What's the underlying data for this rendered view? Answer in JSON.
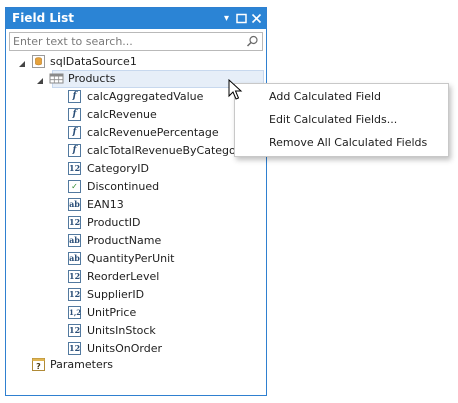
{
  "panel": {
    "title": "Field List",
    "buttons": [
      {
        "name": "dropdown-icon",
        "glyph": "▾"
      },
      {
        "name": "maximize-icon",
        "glyph": "□"
      },
      {
        "name": "close-icon",
        "glyph": "✕"
      }
    ]
  },
  "search": {
    "value": "",
    "placeholder": "Enter text to search...",
    "icon": "search-icon"
  },
  "tree": {
    "datasource": {
      "label": "sqlDataSource1",
      "icon": "database-icon",
      "expanded": true
    },
    "table": {
      "label": "Products",
      "icon": "table-icon",
      "expanded": true,
      "selected": true
    },
    "fields": [
      {
        "label": "calcAggregatedValue",
        "type": "calculated",
        "glyph": "f"
      },
      {
        "label": "calcRevenue",
        "type": "calculated",
        "glyph": "f"
      },
      {
        "label": "calcRevenuePercentage",
        "type": "calculated",
        "glyph": "f"
      },
      {
        "label": "calcTotalRevenueByCategory",
        "type": "calculated",
        "glyph": "f"
      },
      {
        "label": "CategoryID",
        "type": "integer",
        "glyph": "12"
      },
      {
        "label": "Discontinued",
        "type": "boolean",
        "glyph": "✓"
      },
      {
        "label": "EAN13",
        "type": "string",
        "glyph": "ab"
      },
      {
        "label": "ProductID",
        "type": "integer",
        "glyph": "12"
      },
      {
        "label": "ProductName",
        "type": "string",
        "glyph": "ab"
      },
      {
        "label": "QuantityPerUnit",
        "type": "string",
        "glyph": "ab"
      },
      {
        "label": "ReorderLevel",
        "type": "integer",
        "glyph": "12"
      },
      {
        "label": "SupplierID",
        "type": "integer",
        "glyph": "12"
      },
      {
        "label": "UnitPrice",
        "type": "decimal",
        "glyph": "1,2"
      },
      {
        "label": "UnitsInStock",
        "type": "integer",
        "glyph": "12"
      },
      {
        "label": "UnitsOnOrder",
        "type": "integer",
        "glyph": "12"
      }
    ],
    "parameters": {
      "label": "Parameters",
      "icon": "parameters-icon",
      "glyph": "?"
    }
  },
  "context_menu": {
    "items": [
      {
        "label": "Add Calculated Field"
      },
      {
        "label": "Edit Calculated Fields..."
      },
      {
        "label": "Remove All Calculated Fields"
      }
    ]
  },
  "colors": {
    "titlebar": "#2b84d5",
    "selection": "#e6eef8",
    "icon_border": "#52799f"
  }
}
